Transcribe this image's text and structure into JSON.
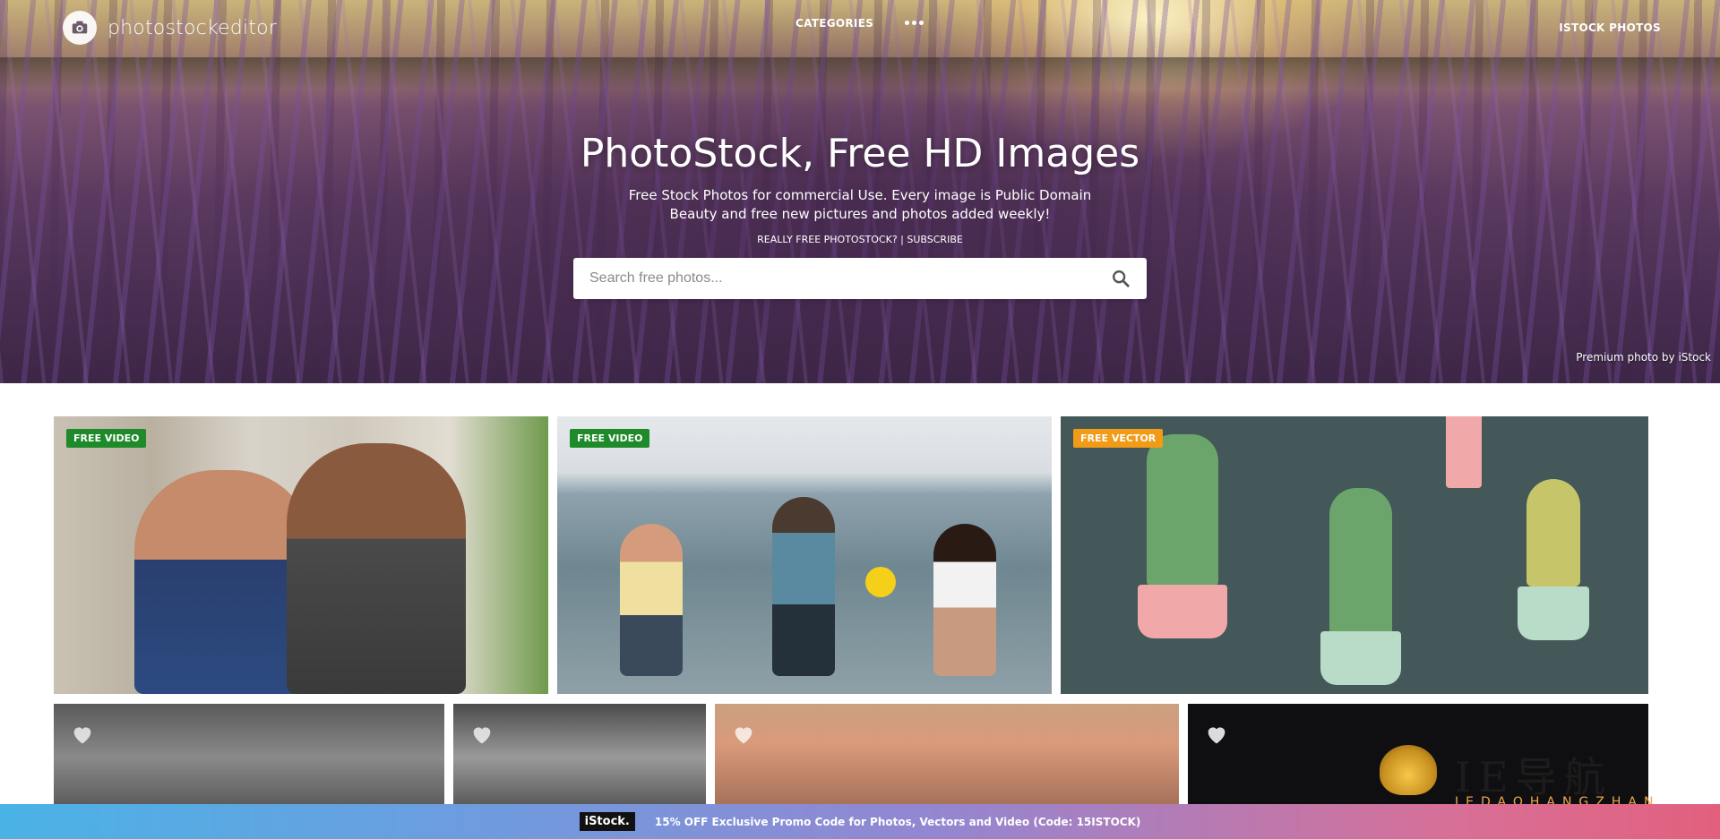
{
  "header": {
    "logo_text": "photostockeditor",
    "nav_categories": "CATEGORIES",
    "nav_istock": "ISTOCK PHOTOS"
  },
  "hero": {
    "title": "PhotoStock, Free HD Images",
    "subtitle_line1": "Free Stock Photos for commercial Use. Every image is Public Domain",
    "subtitle_line2": "Beauty and free new pictures and photos added weekly!",
    "links_line": "REALLY FREE PHOTOSTOCK? | SUBSCRIBE",
    "search_placeholder": "Search free photos...",
    "credit": "Premium photo by iStock"
  },
  "cards": [
    {
      "badge": "FREE VIDEO",
      "badge_color": "#1e8a2a"
    },
    {
      "badge": "FREE VIDEO",
      "badge_color": "#1e8a2a"
    },
    {
      "badge": "FREE VECTOR",
      "badge_color": "#f19b17"
    }
  ],
  "promo": {
    "brand": "iStock.",
    "text": "15% OFF Exclusive Promo Code for Photos, Vectors and Video (Code: 15ISTOCK)"
  },
  "watermark": {
    "word": "IE导航",
    "small": "IEDAOHANGZHAN"
  },
  "icons": {
    "logo": "camera-icon",
    "more": "more-dots-icon",
    "search": "search-icon",
    "favorite": "heart-icon"
  },
  "colors": {
    "badge_green": "#1e8a2a",
    "badge_orange": "#f19b17",
    "promo_start": "#4ab3e6",
    "promo_end": "#e2607e"
  }
}
